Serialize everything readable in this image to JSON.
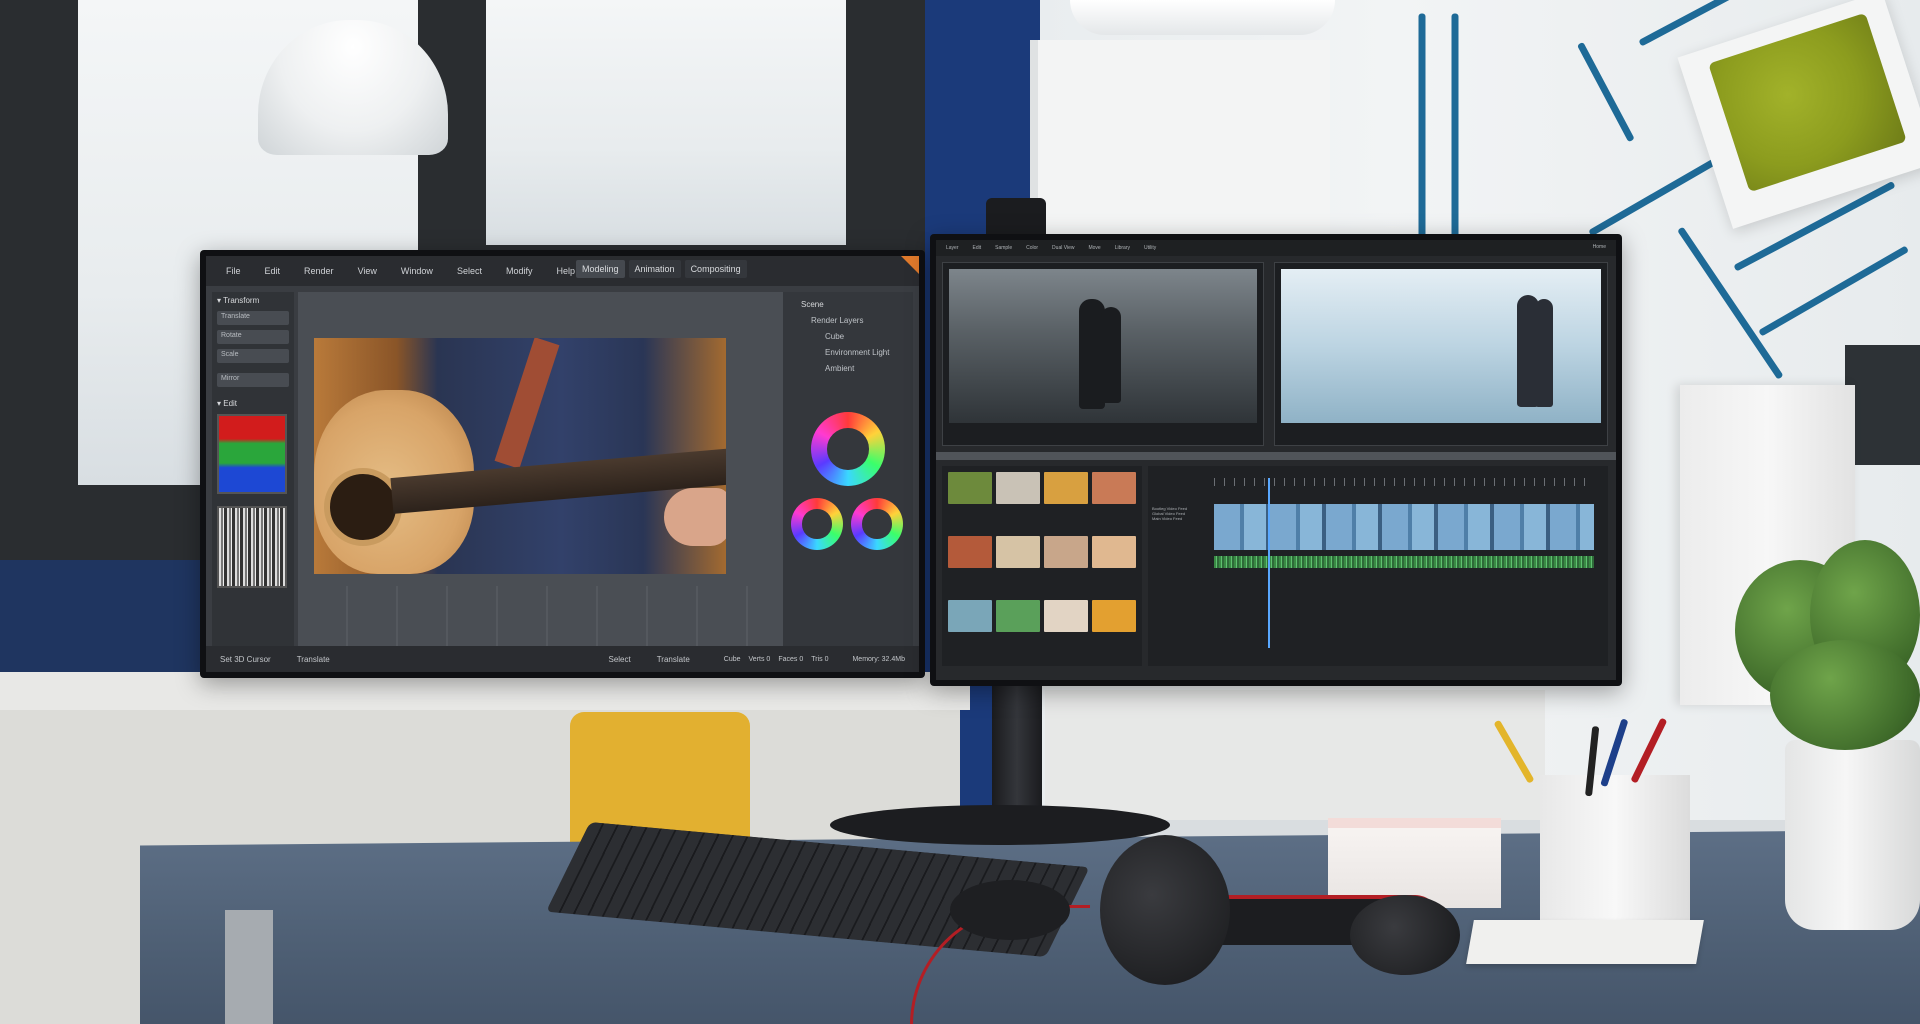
{
  "scene": {
    "description_type": "photo of an office desk with two monitors showing editing software"
  },
  "left_monitor": {
    "menu": [
      "File",
      "Edit",
      "Render",
      "View",
      "Window",
      "Select",
      "Modify",
      "Help"
    ],
    "mode_tabs": [
      "Modeling",
      "Animation",
      "Compositing"
    ],
    "left_panel": {
      "transform_header": "▾ Transform",
      "tools": [
        "Translate",
        "Rotate",
        "Scale",
        "Mirror"
      ],
      "edit_header": "▾ Edit"
    },
    "scene_panel": {
      "header": "Scene",
      "items": [
        "Render Layers",
        "Cube",
        "Environment Light",
        "Ambient"
      ]
    },
    "status": {
      "set_cursor": "Set 3D Cursor",
      "translate_left": "Translate",
      "select": "Select",
      "translate_right": "Translate",
      "cube": "Cube",
      "verts": "Verts 0",
      "faces": "Faces 0",
      "tris": "Tris 0",
      "memory": "Memory: 32.4Mb"
    }
  },
  "right_monitor": {
    "menu": [
      "Layer",
      "Edit",
      "Sample",
      "Color",
      "Dual View",
      "Move",
      "Library",
      "Utility"
    ],
    "top_right_label": "Home",
    "timeline_labels": [
      "Bootleg Video Feed",
      "Global Video Feed",
      "Main Video Feed"
    ],
    "clip_colors": [
      "#6d8a3c",
      "#c9c2b6",
      "#d8a040",
      "#c97a56",
      "#b45a3a",
      "#d6c3a5",
      "#c8a68a",
      "#e0b890",
      "#7aa6b8",
      "#5aa05a",
      "#e2d4c4",
      "#e3a030"
    ]
  },
  "colors": {
    "wall_blue": "#1b3a7a",
    "accent_orange": "#e07a2c",
    "cable_red": "#b31e24",
    "stripe_teal": "#1e6a97"
  }
}
